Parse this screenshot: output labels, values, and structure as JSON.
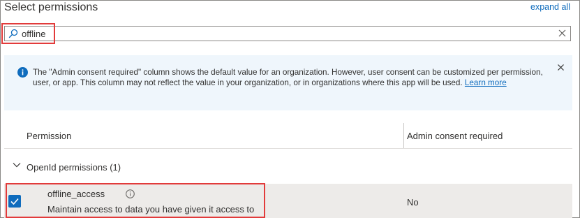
{
  "header": {
    "title": "Select permissions",
    "expand_all": "expand all"
  },
  "search": {
    "value": "offline",
    "icon": "search-icon",
    "clear_icon": "close-icon"
  },
  "banner": {
    "icon": "info-icon",
    "message": "The \"Admin consent required\" column shows the default value for an organization. However, user consent can be customized per permission, user, or app. This column may not reflect the value in your organization, or in organizations where this app will be used.",
    "link_label": "Learn more",
    "close_icon": "close-icon"
  },
  "table": {
    "columns": [
      "Permission",
      "Admin consent required"
    ],
    "group": {
      "label": "OpenId permissions (1)",
      "expanded": true
    },
    "rows": [
      {
        "name": "offline_access",
        "description": "Maintain access to data you have given it access to",
        "admin_consent": "No",
        "checked": true
      }
    ]
  },
  "colors": {
    "accent": "#0f6cbd",
    "highlight": "#e23b3b",
    "banner_bg": "#eff6fc",
    "selected_row_bg": "#edebe9"
  }
}
